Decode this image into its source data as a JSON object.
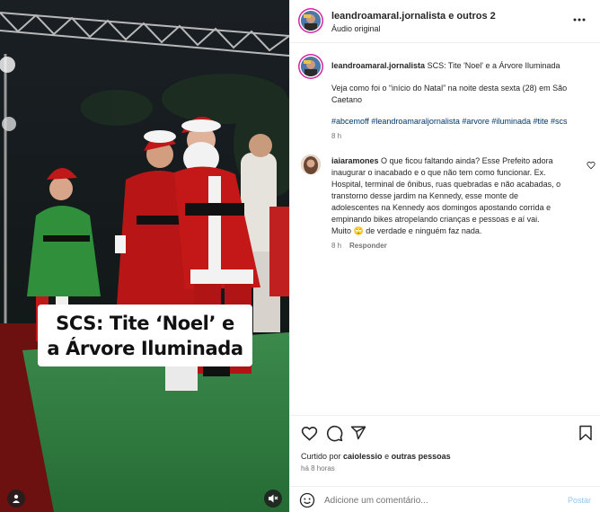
{
  "media": {
    "video_caption_line1": "SCS: Tite ‘Noel’ e",
    "video_caption_line2": "a Árvore Iluminada",
    "icons": {
      "user": "user-tag-icon",
      "mute": "volume-muted-icon"
    }
  },
  "header": {
    "account_line": "leandroamaral.jornalista e outros 2",
    "audio": "Áudio original",
    "more_icon": "more-options-icon"
  },
  "post_caption": {
    "username": "leandroamaral.jornalista",
    "title": "SCS: Tite 'Noel' e a Árvore Iluminada",
    "body_line1": "Veja como foi o “início do Natal” na noite desta sexta (28) em São",
    "body_line2": "Caetano",
    "hashtags": "#abcemoff #leandroamaraljornalista #arvore #iluminada #tite #scs",
    "time": "8 h"
  },
  "comment": {
    "username": "iaiaramones",
    "lines": [
      "O que ficou faltando ainda? Esse Prefeito adora",
      "inaugurar o inacabado e o que não tem como funcionar. Ex.",
      "Hospital, terminal de ônibus, ruas quebradas e não acabadas, o",
      "transtorno desse jardim na Kennedy, esse monte de",
      "adolescentes na Kennedy aos domingos apostando corrida e",
      "empinando bikes atropelando crianças e pessoas e aí vai."
    ],
    "last_line_start": "Muito",
    "emoji": "🙄",
    "last_line_end": "de verdade e ninguém faz nada.",
    "time": "8 h",
    "reply": "Responder"
  },
  "actions": {
    "liked_prefix": "Curtido por ",
    "liked_user": "caiolessio",
    "liked_middle": " e ",
    "liked_others": "outras pessoas",
    "ago": "há 8 horas",
    "icons": [
      "heart-icon",
      "comment-icon",
      "share-icon",
      "bookmark-icon"
    ]
  },
  "add_comment": {
    "placeholder": "Adicione um comentário...",
    "post_label": "Postar"
  },
  "colors": {
    "link": "#00376b",
    "meta": "#737373",
    "post_disabled": "#8ec7f5",
    "turf": "#2f7a3f"
  }
}
